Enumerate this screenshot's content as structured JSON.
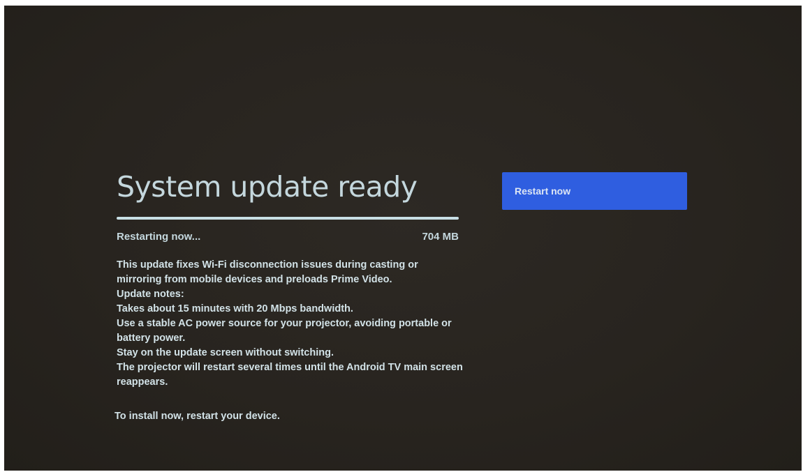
{
  "dialog": {
    "title": "System update ready",
    "progress": 1.0,
    "status": "Restarting now...",
    "size": "704 MB",
    "notes": [
      "This update fixes Wi-Fi disconnection issues during casting or mirroring from mobile devices and preloads Prime Video.",
      "Update notes:",
      "Takes about 15 minutes with 20 Mbps bandwidth.",
      "Use a stable AC power source for your projector, avoiding portable or battery power.",
      "Stay on the update screen without switching.",
      "The projector will restart several times until the Android TV main screen reappears."
    ],
    "instruction": "To install now, restart your device."
  },
  "actions": {
    "restart_label": "Restart now"
  },
  "colors": {
    "background": "#28241f",
    "accent_button": "#2f5ee0",
    "text": "#c4d7dd",
    "progress": "#c8dfe5"
  }
}
